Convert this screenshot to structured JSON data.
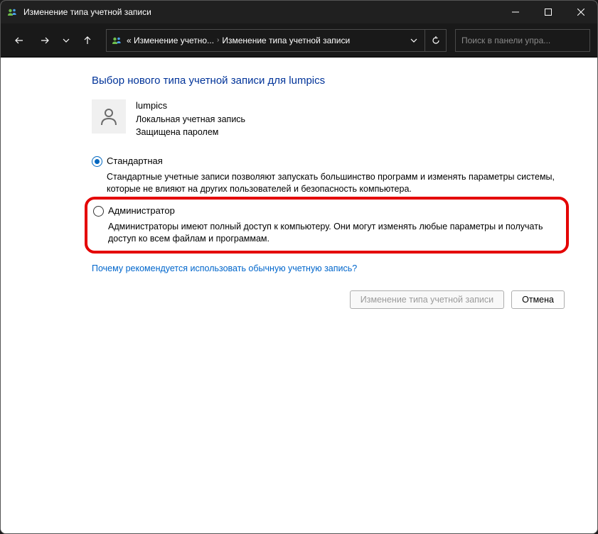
{
  "titlebar": {
    "title": "Изменение типа учетной записи"
  },
  "breadcrumb": {
    "seg1": "« Изменение учетно...",
    "seg2": "Изменение типа учетной записи"
  },
  "search": {
    "placeholder": "Поиск в панели упра..."
  },
  "main": {
    "heading": "Выбор нового типа учетной записи для lumpics",
    "user": {
      "name": "lumpics",
      "line1": "Локальная учетная запись",
      "line2": "Защищена паролем"
    },
    "options": {
      "standard": {
        "label": "Стандартная",
        "desc": "Стандартные учетные записи позволяют запускать большинство программ и изменять параметры системы, которые не влияют на других пользователей и безопасность компьютера."
      },
      "admin": {
        "label": "Администратор",
        "desc": "Администраторы имеют полный доступ к компьютеру. Они могут изменять любые параметры и получать доступ ко всем файлам и программам."
      }
    },
    "help_link": "Почему рекомендуется использовать обычную учетную запись?",
    "buttons": {
      "change": "Изменение типа учетной записи",
      "cancel": "Отмена"
    }
  }
}
